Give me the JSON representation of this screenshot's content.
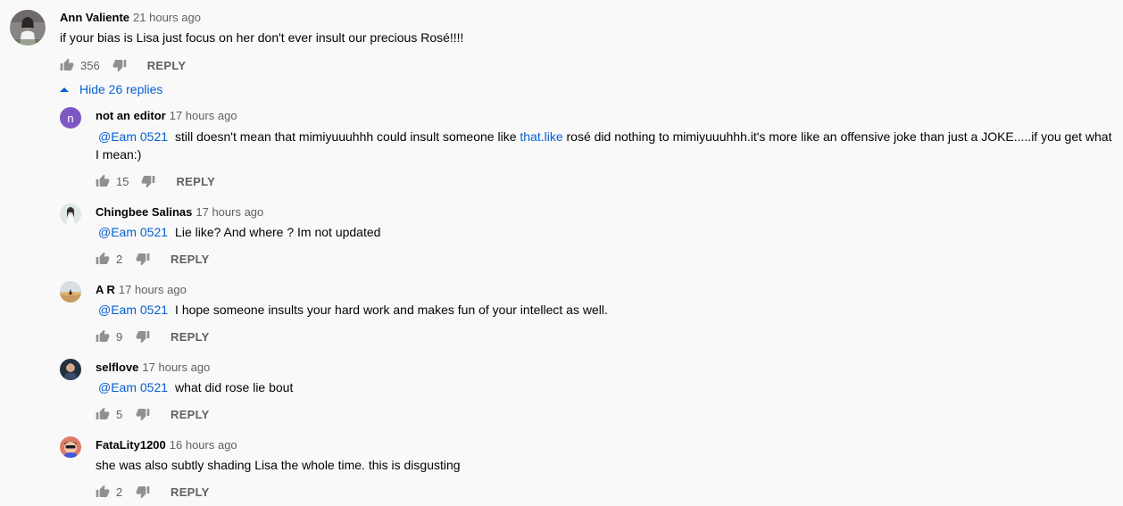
{
  "colors": {
    "link": "#065fd4",
    "muted": "#606060",
    "text": "#030303",
    "background": "#f9f9f9"
  },
  "main_comment": {
    "author": "Ann Valiente",
    "time": "21 hours ago",
    "text": "if your bias is Lisa just focus on her don't ever insult our precious Rosé!!!!",
    "likes": "356",
    "reply_label": "REPLY",
    "avatar_icon": "user-photo-icon"
  },
  "toggle_replies": {
    "label": "Hide 26 replies",
    "icon": "caret-up-icon"
  },
  "replies": [
    {
      "author": "not an editor",
      "time": "17 hours ago",
      "mention": "@Eam 0521",
      "text_before_link": "still doesn't mean that mimiyuuuhhh could insult someone like ",
      "link": "that.like",
      "text_after_link": " rosé did nothing to mimiyuuuhhh.it's more like an offensive joke than just a JOKE.....if you get what I mean:)",
      "likes": "15",
      "reply_label": "REPLY",
      "avatar_letter": "n",
      "avatar_color": "#7e57c2"
    },
    {
      "author": "Chingbee Salinas",
      "time": "17 hours ago",
      "mention": "@Eam 0521",
      "text": "Lie like? And where ? Im not updated",
      "likes": "2",
      "reply_label": "REPLY"
    },
    {
      "author": "A R",
      "time": "17 hours ago",
      "mention": "@Eam 0521",
      "text": "I hope someone insults your hard work and makes fun of your intellect as well.",
      "likes": "9",
      "reply_label": "REPLY"
    },
    {
      "author": "selflove",
      "time": "17 hours ago",
      "mention": "@Eam 0521",
      "text": "what did rose lie bout",
      "likes": "5",
      "reply_label": "REPLY"
    },
    {
      "author": "FataLity1200",
      "time": "16 hours ago",
      "text": "she was also subtly shading Lisa the whole time. this is disgusting",
      "likes": "2",
      "reply_label": "REPLY"
    }
  ]
}
